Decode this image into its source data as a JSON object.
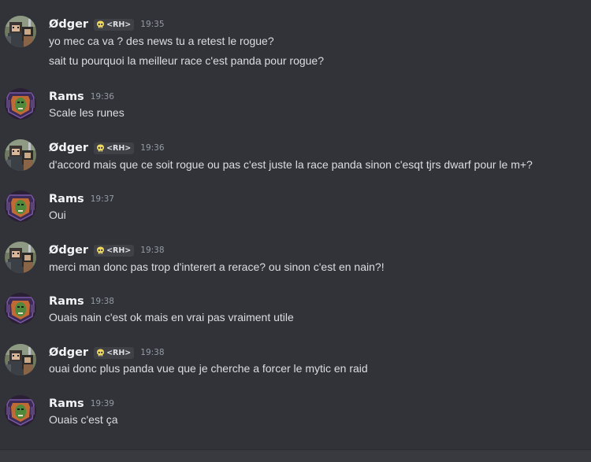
{
  "users": {
    "odger": {
      "name": "Ødger",
      "tag_label": "<RH>",
      "tag_icon": "skull-icon",
      "avatar_icon": "pixel-warrior-avatar-icon"
    },
    "rams": {
      "name": "Rams",
      "avatar_icon": "orc-shield-avatar-icon"
    }
  },
  "colors": {
    "background": "#313338",
    "username": "#f2f3f5",
    "message_text": "#dbdee1",
    "timestamp": "#949ba4",
    "tag_background": "#3f4147",
    "tag_icon": "#f0d95c"
  },
  "messages": [
    {
      "author": "Ødger",
      "tag": "<RH>",
      "time": "19:35",
      "lines": [
        "yo mec ca va ? des news tu a retest le rogue?",
        "sait tu pourquoi la meilleur race c'est panda pour rogue?"
      ]
    },
    {
      "author": "Rams",
      "time": "19:36",
      "lines": [
        "Scale les runes"
      ]
    },
    {
      "author": "Ødger",
      "tag": "<RH>",
      "time": "19:36",
      "lines": [
        "d'accord mais que ce soit rogue ou pas c'est juste la race panda sinon c'esqt tjrs dwarf pour le m+?"
      ]
    },
    {
      "author": "Rams",
      "time": "19:37",
      "lines": [
        "Oui"
      ]
    },
    {
      "author": "Ødger",
      "tag": "<RH>",
      "time": "19:38",
      "lines": [
        "merci man donc pas trop d'interert a rerace? ou sinon c'est en nain?!"
      ]
    },
    {
      "author": "Rams",
      "time": "19:38",
      "lines": [
        "Ouais nain c'est ok mais en vrai pas vraiment utile"
      ]
    },
    {
      "author": "Ødger",
      "tag": "<RH>",
      "time": "19:38",
      "lines": [
        "ouai donc plus panda vue que je cherche a forcer le mytic en raid"
      ]
    },
    {
      "author": "Rams",
      "time": "19:39",
      "lines": [
        "Ouais c'est ça"
      ]
    }
  ]
}
